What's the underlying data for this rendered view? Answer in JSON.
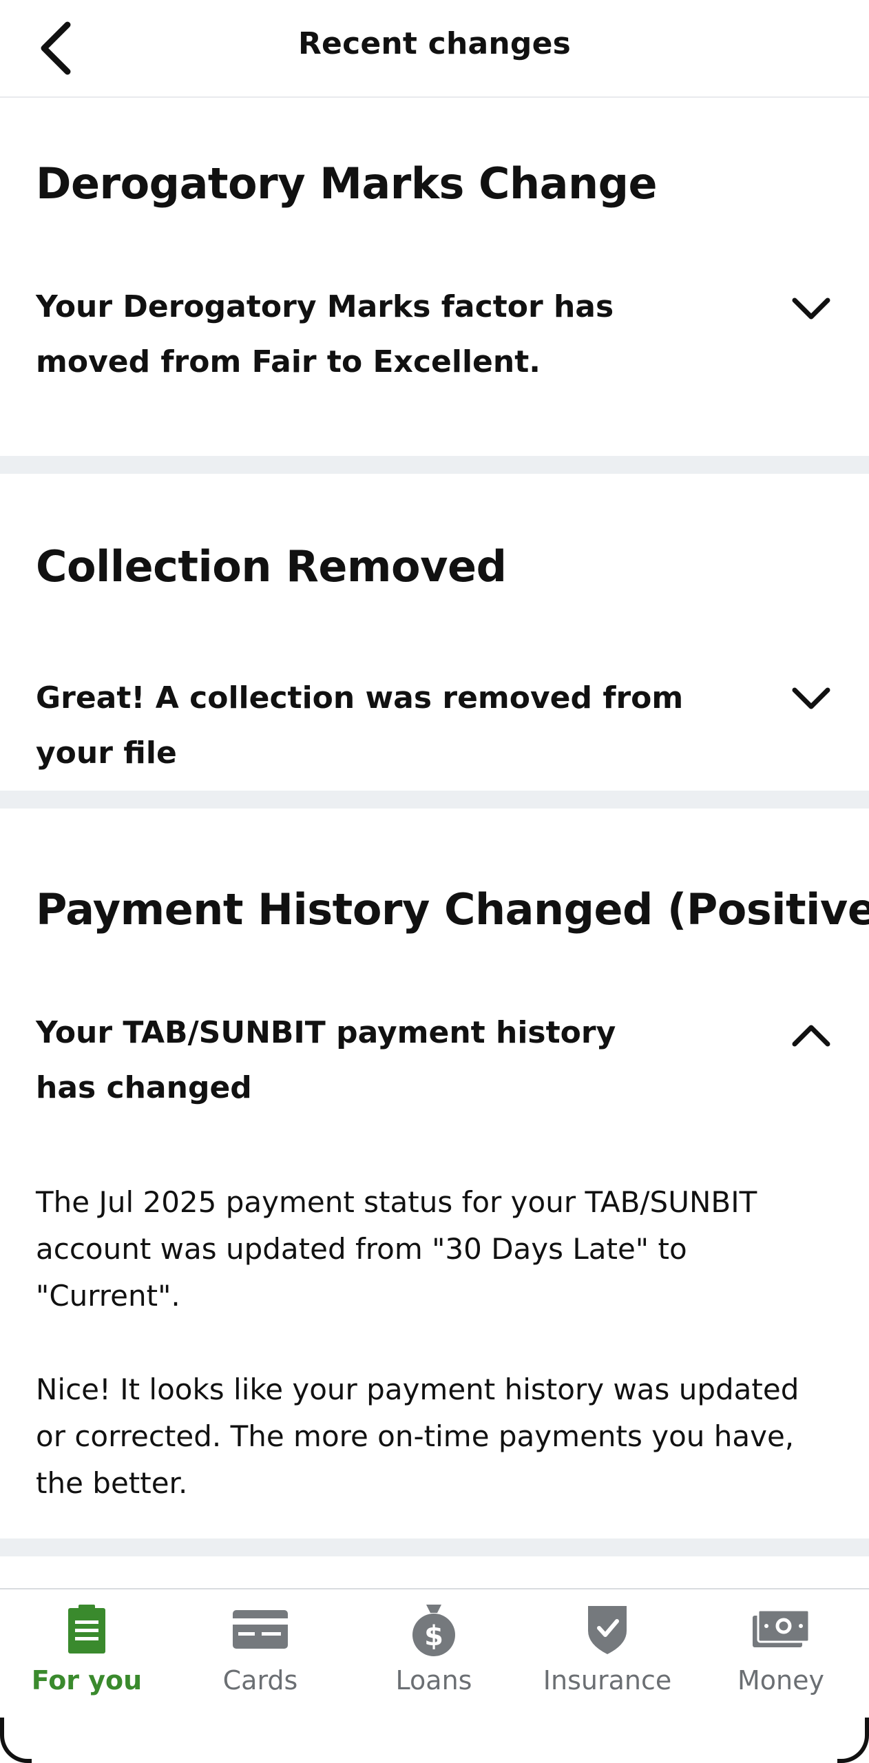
{
  "header": {
    "title": "Recent changes"
  },
  "sections": [
    {
      "title": "Derogatory Marks Change",
      "summary": "Your Derogatory Marks factor has moved from Fair to Excellent.",
      "expanded": false
    },
    {
      "title": "Collection Removed",
      "summary": "Great! A collection was removed from your file",
      "expanded": false
    },
    {
      "title": "Payment History Changed (Positive)",
      "summary": "Your TAB/SUNBIT payment history has changed",
      "expanded": true,
      "details": [
        "The Jul 2025 payment status for your TAB/SUNBIT account was updated from \"30 Days Late\" to \"Current\".",
        "Nice! It looks like your payment history was updated or corrected. The more on-time payments you have, the better."
      ]
    }
  ],
  "tabs": [
    {
      "label": "For you",
      "icon": "document-icon",
      "active": true
    },
    {
      "label": "Cards",
      "icon": "credit-card-icon",
      "active": false
    },
    {
      "label": "Loans",
      "icon": "money-bag-icon",
      "active": false
    },
    {
      "label": "Insurance",
      "icon": "shield-check-icon",
      "active": false
    },
    {
      "label": "Money",
      "icon": "cash-icon",
      "active": false
    }
  ],
  "colors": {
    "active_tab": "#3a8a2d",
    "inactive_tab": "#6b6f73",
    "separator": "#eceff2"
  }
}
